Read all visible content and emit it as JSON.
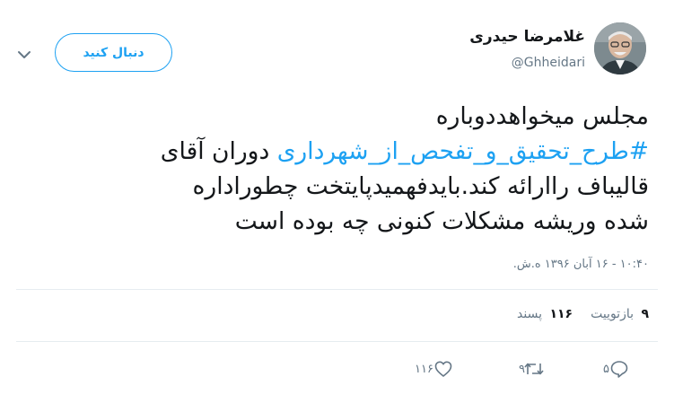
{
  "header": {
    "display_name": "غلامرضا حیدری",
    "handle": "@Ghheidari",
    "follow_label": "دنبال کنید"
  },
  "tweet": {
    "line1": "مجلس میخواهددوباره",
    "line2_hashtag": "#طرح_تحقیق_و_تفحص_از_شهرداری",
    "line2_rest": " دوران آقای",
    "line3": "قالیباف راارائه کند.بایدفهمیدپایتخت چطوراداره",
    "line4": "شده وریشه مشکلات کنونی چه بوده است"
  },
  "timestamp": "۱۰:۴۰ - ۱۶ آبان ۱۳۹۶ ه.ش.",
  "stats": {
    "retweets_count": "۹",
    "retweets_label": "بازتوییت",
    "likes_count": "۱۱۶",
    "likes_label": "پسند"
  },
  "actions": {
    "reply_count": "۵",
    "retweet_count": "۹",
    "like_count": "۱۱۶"
  },
  "colors": {
    "accent": "#1da1f2",
    "muted": "#657786",
    "divider": "#e6ecf0"
  },
  "icons": [
    "chevron-down-icon",
    "reply-icon",
    "retweet-icon",
    "heart-icon"
  ]
}
